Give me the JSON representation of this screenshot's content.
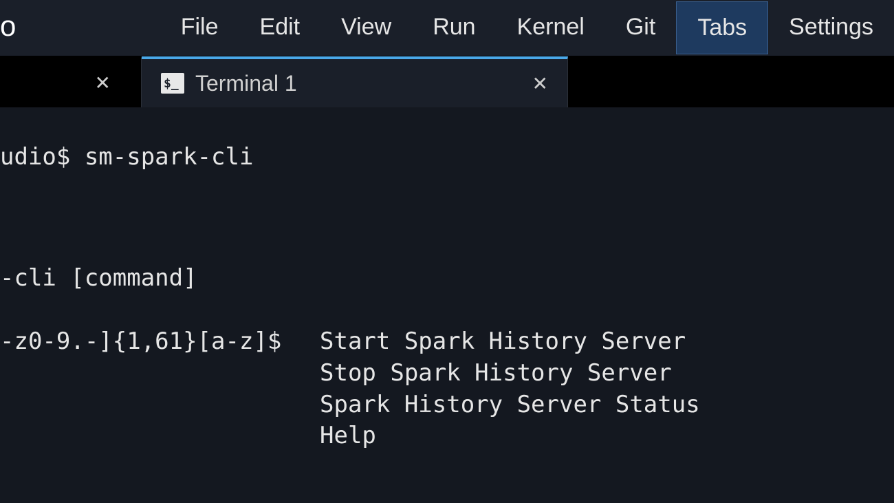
{
  "logo_fragment": "o",
  "menu": {
    "items": [
      "File",
      "Edit",
      "View",
      "Run",
      "Kernel",
      "Git",
      "Tabs",
      "Settings"
    ],
    "active_index": 6
  },
  "tabs": {
    "prev_close": "✕",
    "active": {
      "icon_text": "$_",
      "title": "Terminal 1",
      "close": "✕"
    }
  },
  "terminal": {
    "prompt_line": "udio$ sm-spark-cli",
    "usage_line": "-cli [command]",
    "regex_left": "-z0-9.-]{1,61}[a-z]$",
    "desc_start": "Start Spark History Server",
    "desc_stop": "Stop Spark History Server",
    "desc_status": "Spark History Server Status",
    "desc_help": "Help"
  }
}
